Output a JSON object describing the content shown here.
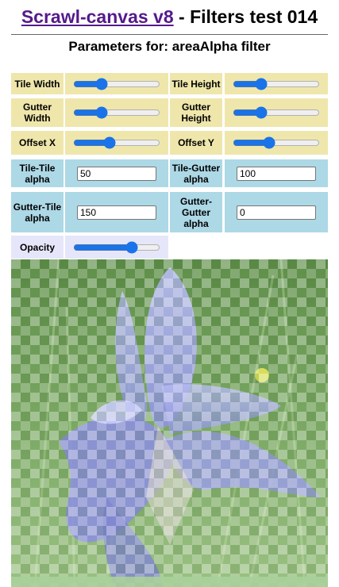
{
  "header": {
    "link_text": "Scrawl-canvas v8",
    "title_suffix": " - Filters test 014",
    "subtitle": "Parameters for: areaAlpha filter"
  },
  "controls": {
    "tile_width": {
      "label": "Tile Width",
      "value": 0.3
    },
    "tile_height": {
      "label": "Tile Height",
      "value": 0.3
    },
    "gutter_width": {
      "label": "Gutter Width",
      "value": 0.3
    },
    "gutter_height": {
      "label": "Gutter Height",
      "value": 0.3
    },
    "offset_x": {
      "label": "Offset X",
      "value": 0.4
    },
    "offset_y": {
      "label": "Offset Y",
      "value": 0.4
    },
    "tile_tile_alpha": {
      "label": "Tile-Tile alpha",
      "value": "50"
    },
    "tile_gutter_alpha": {
      "label": "Tile-Gutter alpha",
      "value": "100"
    },
    "gutter_tile_alpha": {
      "label": "Gutter-Tile alpha",
      "value": "150"
    },
    "gutter_gutter_alpha": {
      "label": "Gutter-Gutter alpha",
      "value": "0"
    },
    "opacity": {
      "label": "Opacity",
      "value": 0.7
    }
  },
  "colors": {
    "label_yellow": "#efe6ab",
    "label_blue": "#add8e6",
    "label_lavender": "#e6e6fa",
    "link": "#551a8b"
  }
}
